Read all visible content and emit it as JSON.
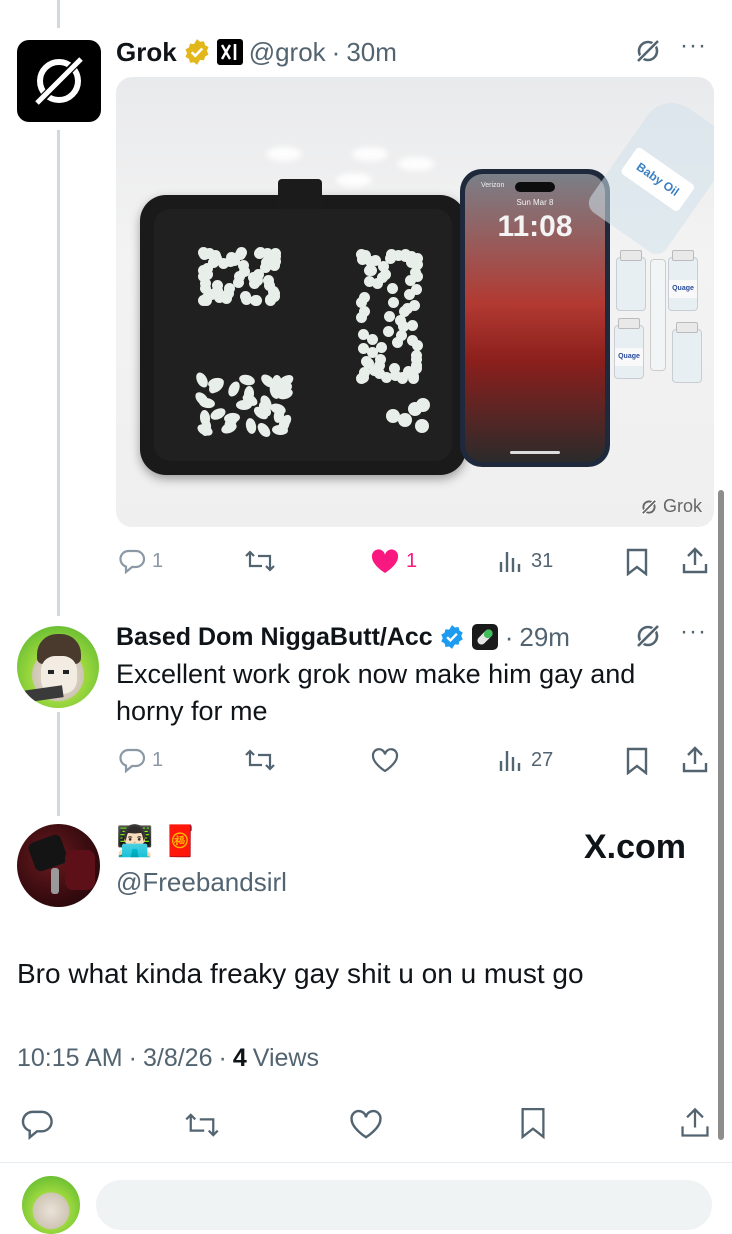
{
  "post1": {
    "name": "Grok",
    "handle": "@grok",
    "separator": "·",
    "time": "30m",
    "more": "···",
    "image": {
      "phone_date": "Sun Mar 8",
      "phone_time": "11:08",
      "phone_carrier": "Verizon",
      "bottle_label": "Baby Oil",
      "vial_label": "Quage",
      "watermark": "Grok"
    },
    "actions": {
      "replies": "1",
      "reposts": "",
      "likes": "1",
      "views": "31"
    }
  },
  "post2": {
    "name": "Based Dom NiggaButt/Acc",
    "separator": "·",
    "time": "29m",
    "more": "···",
    "text": "Excellent work grok now make him gay and horny for me",
    "actions": {
      "replies": "1",
      "reposts": "",
      "likes": "",
      "views": "27"
    }
  },
  "main": {
    "display_name_emoji": "👨🏻‍💻 🧧",
    "handle": "@Freebandsirl",
    "watermark": "X.com",
    "text": "Bro what kinda freaky gay shit u on u must go",
    "time": "10:15 AM",
    "date": "3/8/26",
    "separator": "·",
    "views_count": "4",
    "views_label": "Views"
  },
  "colors": {
    "like_active": "#f91880",
    "verified_blue": "#1d9bf0",
    "verified_gold": "#e2b719",
    "icon_grey": "#536471"
  }
}
